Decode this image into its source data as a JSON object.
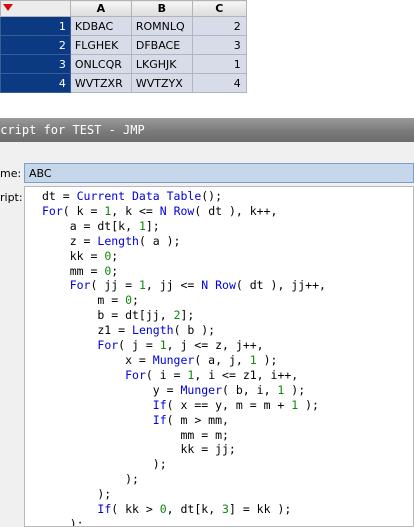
{
  "data_table": {
    "columns": [
      "A",
      "B",
      "C"
    ],
    "rows": [
      {
        "row": "1",
        "A": "KDBAC",
        "B": "ROMNLQ",
        "C": "2"
      },
      {
        "row": "2",
        "A": "FLGHEK",
        "B": "DFBACE",
        "C": "3"
      },
      {
        "row": "3",
        "A": "ONLCQR",
        "B": "LKGHJK",
        "C": "1"
      },
      {
        "row": "4",
        "A": "WVTZXR",
        "B": "WVTZYX",
        "C": "4"
      }
    ]
  },
  "script_window": {
    "title": "Script for TEST - JMP",
    "name_label": "me:",
    "name_value": "ABC",
    "script_label": "ript:",
    "code_lines": [
      "dt = Current Data Table();",
      "For( k = 1, k <= N Row( dt ), k++,",
      "    a = dt[k, 1];",
      "    z = Length( a );",
      "    kk = 0;",
      "    mm = 0;",
      "    For( jj = 1, jj <= N Row( dt ), jj++,",
      "        m = 0;",
      "        b = dt[jj, 2];",
      "        z1 = Length( b );",
      "        For( j = 1, j <= z, j++,",
      "            x = Munger( a, j, 1 );",
      "            For( i = 1, i <= z1, i++,",
      "                y = Munger( b, i, 1 );",
      "                If( x == y, m = m + 1 );",
      "                If( m > mm,",
      "                    mm = m;",
      "                    kk = jj;",
      "                );",
      "            );",
      "        );",
      "        If( kk > 0, dt[k, 3] = kk );",
      "    );",
      ");"
    ]
  },
  "colors": {
    "row_header": "#0b3a82",
    "selected_cell": "#d8dce9",
    "name_field": "#c6d7ec",
    "keyword": "#0000e0",
    "number": "#0a8a0a"
  }
}
